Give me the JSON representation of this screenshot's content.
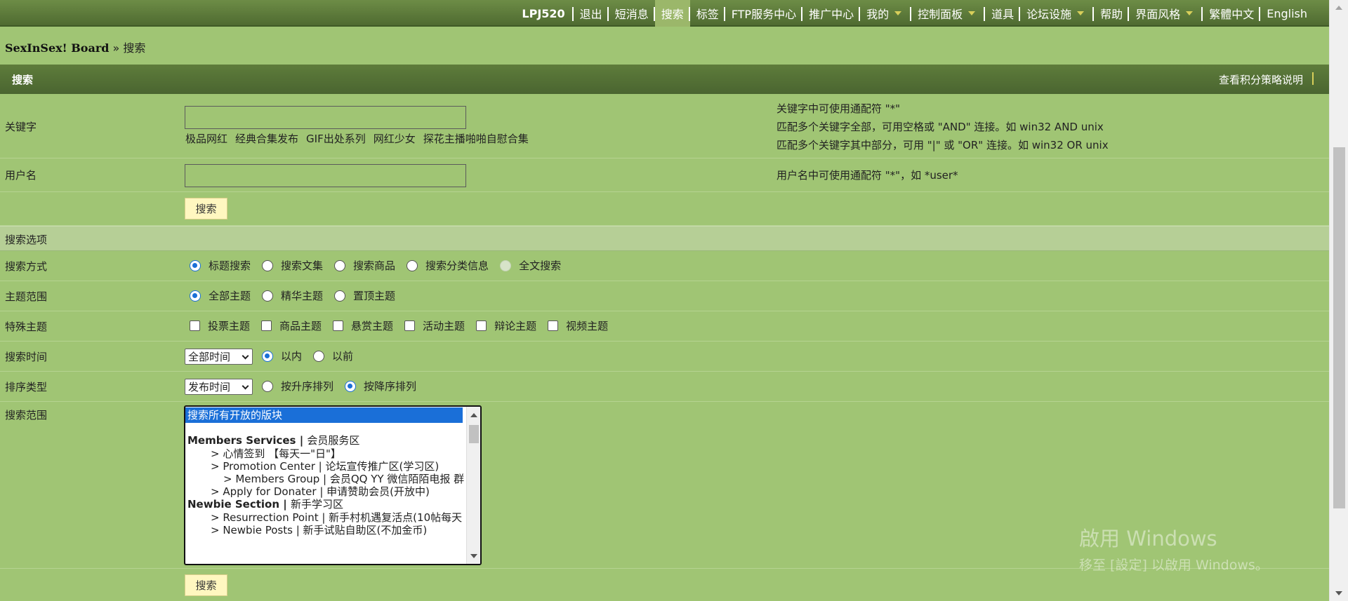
{
  "nav": {
    "items": [
      {
        "label": "LPJ520",
        "bold": true
      },
      {
        "label": "退出"
      },
      {
        "label": "短消息"
      },
      {
        "label": "搜索",
        "active": true
      },
      {
        "label": "标签"
      },
      {
        "label": "FTP服务中心"
      },
      {
        "label": "推广中心"
      },
      {
        "label": "我的",
        "caret": true
      },
      {
        "label": "控制面板",
        "caret": true
      },
      {
        "label": "道具"
      },
      {
        "label": "论坛设施",
        "caret": true
      },
      {
        "label": "帮助"
      },
      {
        "label": "界面风格",
        "caret": true
      },
      {
        "label": "繁體中文"
      },
      {
        "label": "English"
      }
    ]
  },
  "breadcrumb": {
    "site": "SexInSex! Board",
    "sep": "»",
    "current": "搜索"
  },
  "header": {
    "title": "搜索",
    "policy_link": "查看积分策略说明"
  },
  "keyword": {
    "label": "关键字",
    "value": "",
    "hot_tags": [
      "极品网红",
      "经典合集发布",
      "GIF出处系列",
      "网红少女",
      "探花主播啪啪自慰合集"
    ],
    "hint_lines": [
      "关键字中可使用通配符 \"*\"",
      "匹配多个关键字全部，可用空格或 \"AND\" 连接。如 win32 AND unix",
      "匹配多个关键字其中部分，可用 \"|\" 或 \"OR\" 连接。如 win32 OR unix"
    ]
  },
  "username": {
    "label": "用户名",
    "value": "",
    "hint": "用户名中可使用通配符 \"*\"，如 *user*"
  },
  "search_button": "搜索",
  "options_title": "搜索选项",
  "search_mode": {
    "label": "搜索方式",
    "options": [
      "标题搜索",
      "搜索文集",
      "搜索商品",
      "搜索分类信息",
      "全文搜索"
    ],
    "selected": 0,
    "disabled": [
      4
    ]
  },
  "thread_scope": {
    "label": "主题范围",
    "options": [
      "全部主题",
      "精华主题",
      "置顶主题"
    ],
    "selected": 0
  },
  "special": {
    "label": "特殊主题",
    "options": [
      "投票主题",
      "商品主题",
      "悬赏主题",
      "活动主题",
      "辩论主题",
      "视频主题"
    ]
  },
  "time": {
    "label": "搜索时间",
    "select": "全部时间",
    "options": [
      "以内",
      "以前"
    ],
    "selected": 0
  },
  "sort": {
    "label": "排序类型",
    "select": "发布时间",
    "options": [
      "按升序排列",
      "按降序排列"
    ],
    "selected": 1
  },
  "forums": {
    "label": "搜索范围",
    "items": [
      {
        "text": "搜索所有开放的版块",
        "selected": true
      },
      {
        "text": ""
      },
      {
        "group": "Members Services",
        "sub": "会员服务区"
      },
      {
        "text": "> 心情签到 【每天一\"日\"】",
        "indent": 1
      },
      {
        "text": "> Promotion Center | 论坛宣传推广区(学习区)",
        "indent": 1
      },
      {
        "text": "> Members Group | 会员QQ YY 微信陌陌电报 群",
        "indent": 2
      },
      {
        "text": "> Apply for Donater | 申请赞助会员(开放中)",
        "indent": 1
      },
      {
        "group": "Newbie Section",
        "sub": "新手学习区"
      },
      {
        "text": "> Resurrection Point | 新手村机遇复活点(10帖每天",
        "indent": 1
      },
      {
        "text": "> Newbie Posts | 新手试贴自助区(不加金币)",
        "indent": 1
      }
    ]
  },
  "watermark": {
    "line1": "啟用 Windows",
    "line2": "移至 [設定] 以啟用 Windows。"
  }
}
